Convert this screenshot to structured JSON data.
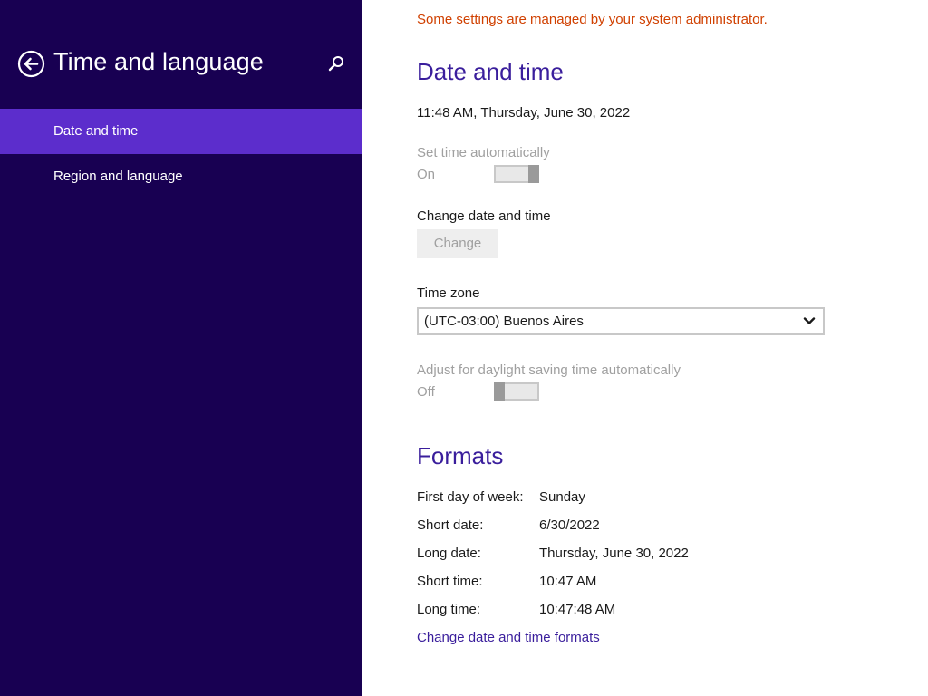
{
  "colors": {
    "sidebar_bg": "#180052",
    "selected_item_bg": "#5c2dcc",
    "accent": "#3a1e9c",
    "warning": "#d04000",
    "disabled": "#a0a0a0"
  },
  "sidebar": {
    "back_icon": "back-arrow-circle-icon",
    "title": "Time and language",
    "search_icon": "search-icon",
    "items": [
      {
        "label": "Date and time",
        "selected": true
      },
      {
        "label": "Region and language",
        "selected": false
      }
    ]
  },
  "main": {
    "admin_notice": "Some settings are managed by your system administrator.",
    "date_time": {
      "title": "Date and time",
      "current": "11:48 AM, Thursday, June 30, 2022",
      "set_auto_label": "Set time automatically",
      "set_auto_state": "On",
      "change_label": "Change date and time",
      "change_button": "Change",
      "timezone_label": "Time zone",
      "timezone_value": "(UTC-03:00) Buenos Aires",
      "dst_label": "Adjust for daylight saving time automatically",
      "dst_state": "Off"
    },
    "formats": {
      "title": "Formats",
      "rows": [
        {
          "key": "First day of week:",
          "value": "Sunday"
        },
        {
          "key": "Short date:",
          "value": "6/30/2022"
        },
        {
          "key": "Long date:",
          "value": "Thursday, June 30, 2022"
        },
        {
          "key": "Short time:",
          "value": "10:47 AM"
        },
        {
          "key": "Long time:",
          "value": "10:47:48 AM"
        }
      ],
      "change_link": "Change date and time formats"
    }
  }
}
